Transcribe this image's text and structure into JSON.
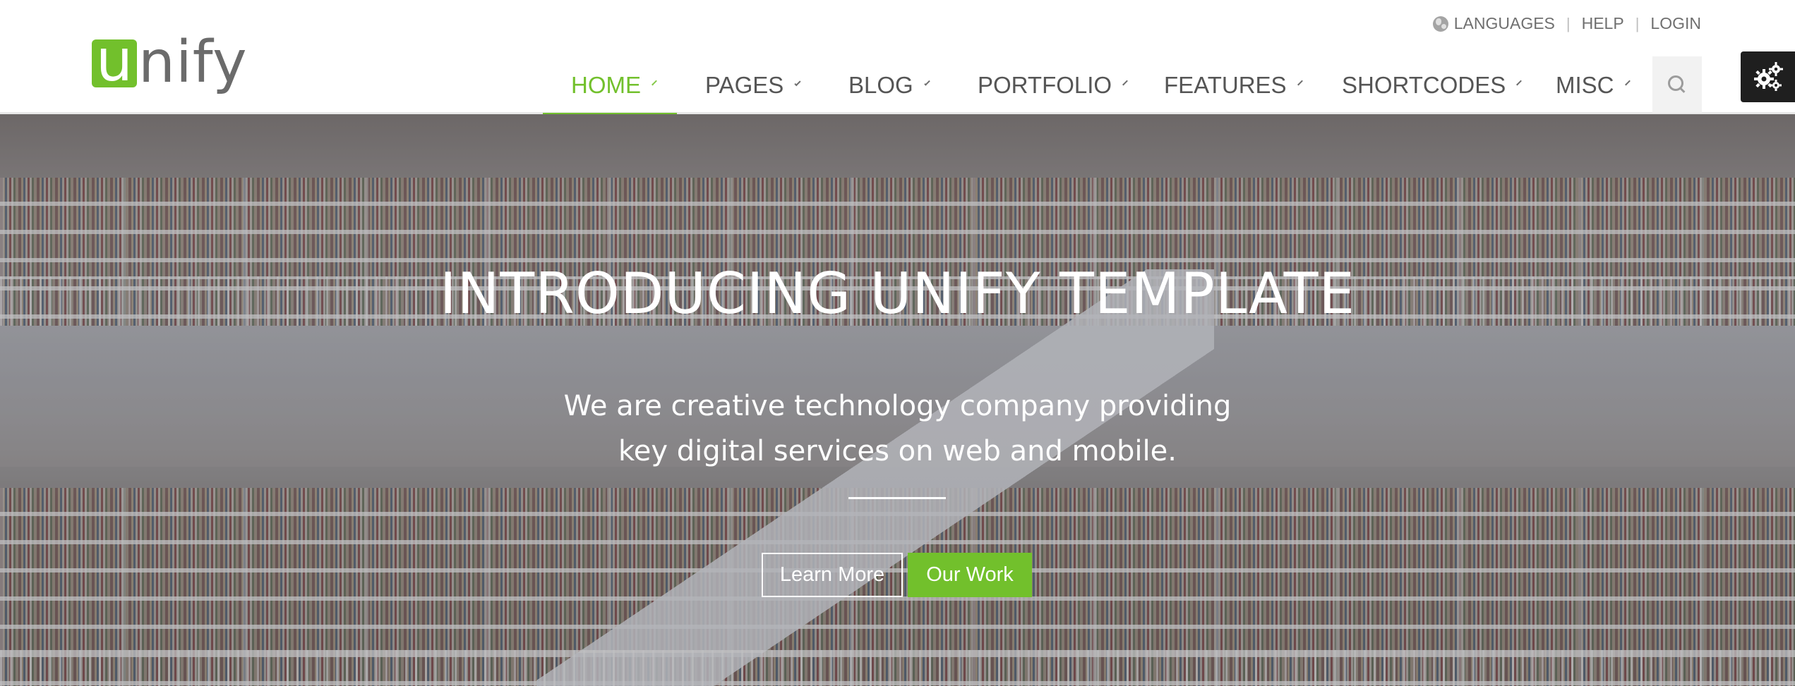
{
  "brand": {
    "logo_letter": "u",
    "logo_rest": "nify",
    "accent_color": "#72c02c"
  },
  "topbar": {
    "languages": "LANGUAGES",
    "help": "HELP",
    "login": "LOGIN",
    "separator": "|",
    "languages_icon": "globe-icon"
  },
  "nav": {
    "items": [
      {
        "label": "HOME",
        "active": true
      },
      {
        "label": "PAGES"
      },
      {
        "label": "BLOG"
      },
      {
        "label": "PORTFOLIO"
      },
      {
        "label": "FEATURES"
      },
      {
        "label": "SHORTCODES"
      },
      {
        "label": "MISC"
      }
    ],
    "search_icon": "search-icon",
    "settings_icon": "gears-icon"
  },
  "hero": {
    "title": "INTRODUCING UNIFY TEMPLATE",
    "subtitle_line1": "We are creative technology company providing",
    "subtitle_line2": "key digital services on web and mobile.",
    "learn_more": "Learn More",
    "our_work": "Our Work"
  }
}
